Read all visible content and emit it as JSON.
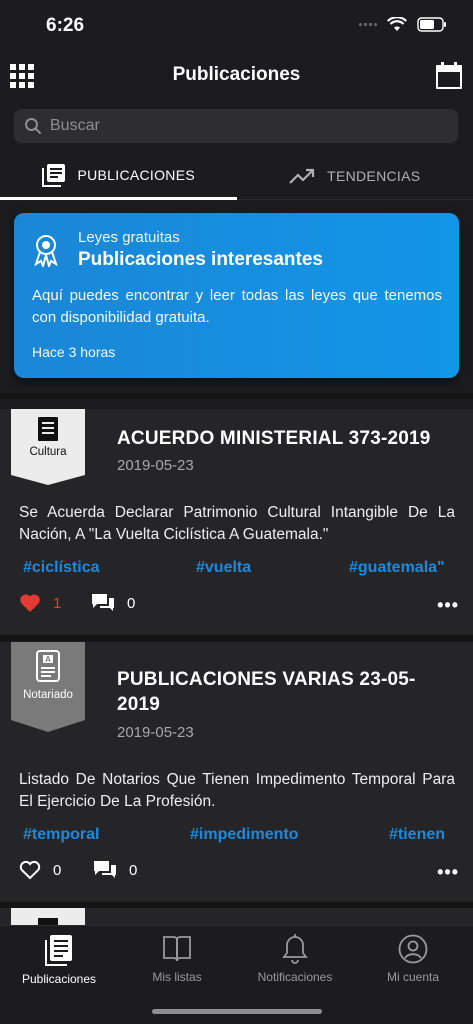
{
  "status": {
    "time": "6:26"
  },
  "nav": {
    "title": "Publicaciones",
    "left_icon": "grid-icon",
    "right_icon": "calendar-icon"
  },
  "search": {
    "placeholder": "Buscar",
    "value": ""
  },
  "tabs": [
    {
      "label": "PUBLICACIONES",
      "icon": "publications-icon",
      "active": true
    },
    {
      "label": "TENDENCIAS",
      "icon": "trending-icon",
      "active": false
    }
  ],
  "promo": {
    "subtitle": "Leyes gratuitas",
    "title": "Publicaciones interesantes",
    "text": "Aquí puedes encontrar y leer todas las leyes que tenemos con disponibilidad gratuita.",
    "time": "Hace 3 horas",
    "icon": "award-ribbon-icon",
    "color": "#1b8fe0"
  },
  "publications": [
    {
      "category": "Cultura",
      "category_icon": "document-icon",
      "title": "ACUERDO MINISTERIAL 373-2019",
      "date": "2019-05-23",
      "description": "Se Acuerda Declarar Patrimonio Cultural Intangible De La Nación, A \"La Vuelta Ciclística A Guatemala.\"",
      "tags": [
        "#ciclística",
        "#vuelta",
        "#guatemala\""
      ],
      "likes": "1",
      "liked": true,
      "comments": "0"
    },
    {
      "category": "Notariado",
      "category_icon": "notary-document-icon",
      "title": "PUBLICACIONES VARIAS 23-05-2019",
      "date": "2019-05-23",
      "description": "Listado De Notarios Que Tienen Impedimento Temporal Para El Ejercicio De La Profesión.",
      "tags": [
        "#temporal",
        "#impedimento",
        "#tienen"
      ],
      "likes": "0",
      "liked": false,
      "comments": "0"
    }
  ],
  "more_label": "•••",
  "tabbar": [
    {
      "label": "Publicaciones",
      "icon": "publications-icon",
      "active": true
    },
    {
      "label": "Mis listas",
      "icon": "book-icon",
      "active": false
    },
    {
      "label": "Notificaciones",
      "icon": "bell-icon",
      "active": false
    },
    {
      "label": "Mi cuenta",
      "icon": "user-icon",
      "active": false
    }
  ],
  "colors": {
    "background": "#1c1c1e",
    "card": "#252527",
    "accent": "#1a8ae0",
    "like": "#e53935"
  }
}
